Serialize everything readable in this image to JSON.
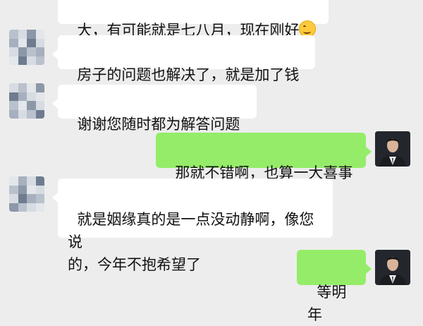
{
  "chat": {
    "messages": [
      {
        "sender": "contact",
        "text": "大，有可能就是七八月，现在刚好"
      },
      {
        "sender": "contact",
        "text": "房子的问题也解决了，就是加了钱"
      },
      {
        "sender": "contact",
        "text": "谢谢您随时都为解答问题"
      },
      {
        "sender": "me",
        "text": "那就不错啊，也算一大喜事"
      },
      {
        "sender": "contact",
        "text": "就是姻缘真的是一点没动静啊，像您说\n的，今年不抱希望了"
      },
      {
        "sender": "me",
        "text": "等明年"
      }
    ],
    "emoji_icon": "smiling-face-icon",
    "contact_avatar_icon": "pixelated-avatar-icon",
    "my_avatar_icon": "profile-photo-avatar-icon",
    "colors": {
      "background": "#ededed",
      "incoming_bubble": "#ffffff",
      "outgoing_bubble": "#95ec69"
    }
  }
}
